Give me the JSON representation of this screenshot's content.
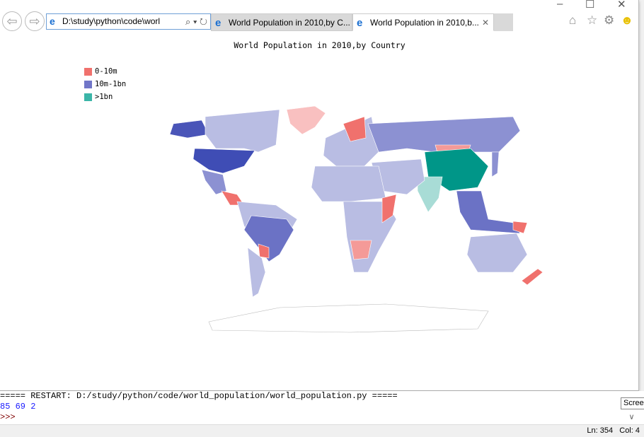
{
  "browser": {
    "address": "D:\\study\\python\\code\\worl",
    "tabs": [
      {
        "label": "World Population in 2010,by C...",
        "active": false
      },
      {
        "label": "World Population in 2010,b...",
        "active": true
      }
    ],
    "icons": [
      "back-icon",
      "forward-icon",
      "search-icon",
      "refresh-icon",
      "home-icon",
      "star-icon",
      "gear-icon",
      "smiley-icon"
    ]
  },
  "chart_data": {
    "type": "choropleth-map",
    "title": "World Population in 2010,by Country",
    "legend": [
      {
        "label": "0-10m",
        "color": "#f0716d"
      },
      {
        "label": "10m-1bn",
        "color": "#7176c8"
      },
      {
        "label": ">1bn",
        "color": "#3bb5a8"
      }
    ],
    "legend_placement": "top-left"
  },
  "shell": {
    "restart_line": "===== RESTART: D:/study/python/code/world_population/world_population.py =====",
    "output_line": "85 69 2",
    "prompt": ">>>"
  },
  "tooltip": "Scree",
  "status": {
    "line": "Ln: 354",
    "col": "Col: 4"
  }
}
